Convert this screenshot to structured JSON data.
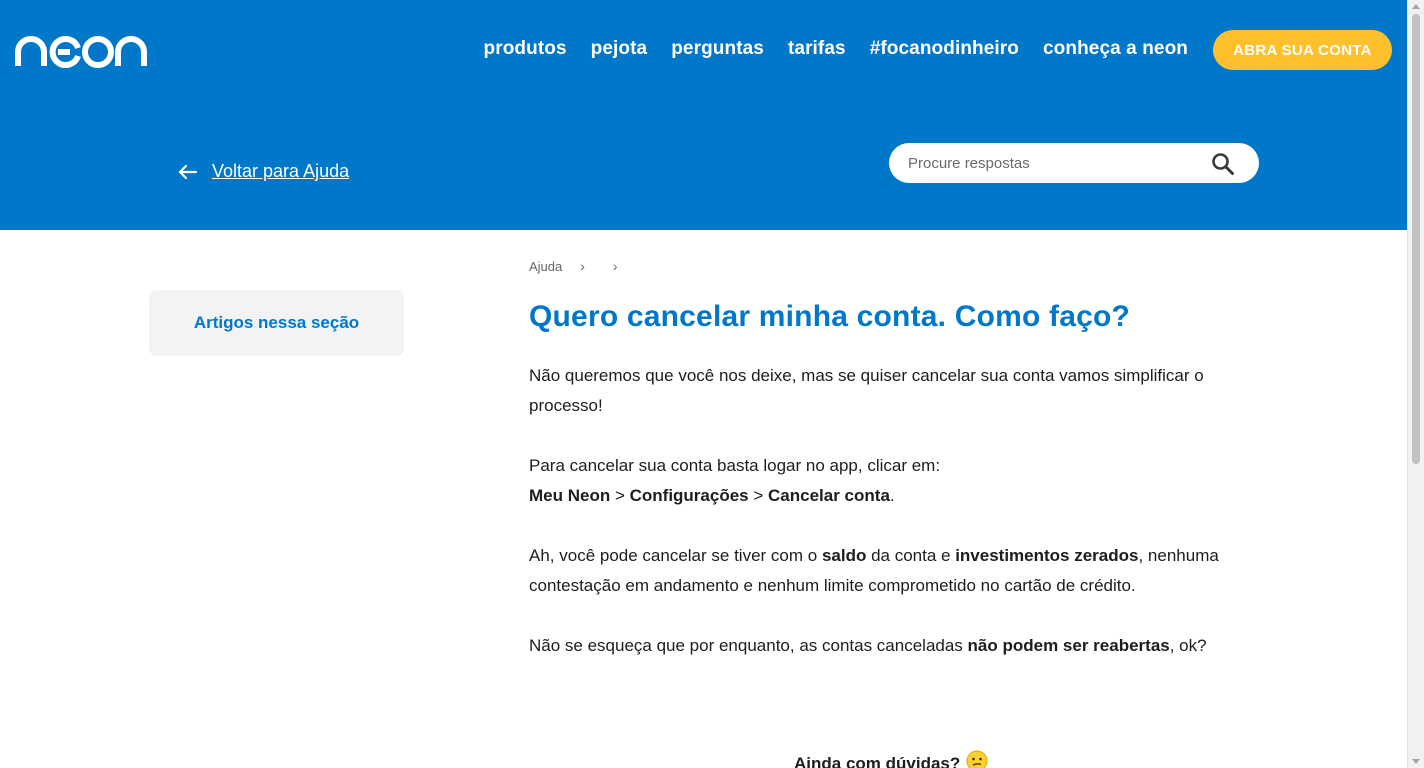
{
  "brand": {
    "logo_text": "neon",
    "primary": "#0077c8",
    "accent": "#fec12d"
  },
  "nav": {
    "items": [
      {
        "label": "produtos"
      },
      {
        "label": "pejota"
      },
      {
        "label": "perguntas"
      },
      {
        "label": "tarifas"
      },
      {
        "label": "#focanodinheiro"
      },
      {
        "label": "conheça a neon"
      }
    ],
    "cta_label": "ABRA SUA CONTA"
  },
  "back_link": {
    "label": "Voltar para Ajuda",
    "icon": "arrow-left-icon"
  },
  "search": {
    "placeholder": "Procure respostas",
    "icon": "search-icon"
  },
  "sidebar": {
    "section_label": "Artigos nessa seção"
  },
  "breadcrumb": {
    "items": [
      "Ajuda"
    ]
  },
  "article": {
    "title": "Quero cancelar minha conta. Como faço?",
    "p1": "Não queremos que você nos deixe, mas se quiser cancelar sua conta vamos simplificar o processo!",
    "p2_intro": "Para cancelar sua conta basta logar no app, clicar em:",
    "path": [
      "Meu Neon",
      "Configurações",
      "Cancelar conta"
    ],
    "path_sep": " > ",
    "path_end": ".",
    "p3": {
      "t1": "Ah, você pode cancelar se tiver com o ",
      "b1": "saldo",
      "t2": " da conta e ",
      "b2": "investimentos zerados",
      "t3": ", nenhuma contestação em andamento e nenhum limite comprometido no cartão de crédito."
    },
    "p4": {
      "t1": "Não se esqueça que por enquanto, as contas canceladas ",
      "b1": "não podem ser reabertas",
      "t2": ", ok?"
    }
  },
  "footer_prompt": {
    "label": "Ainda com dúvidas?",
    "icon": "thinking-face-icon"
  }
}
